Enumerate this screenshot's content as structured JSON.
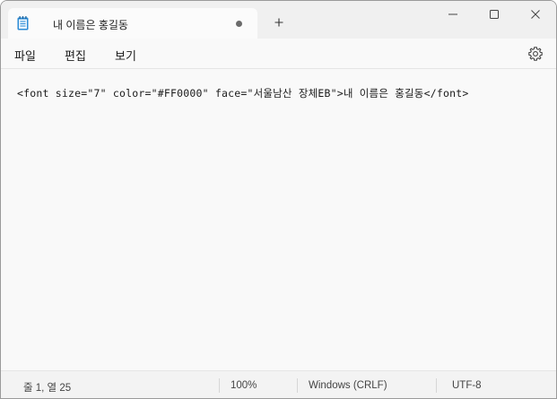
{
  "tab": {
    "title": "내 이름은 홍길동",
    "app_icon": "notepad-icon",
    "unsaved": true
  },
  "titlebar": {
    "new_tab_icon": "plus-icon",
    "controls": [
      "minimize-icon",
      "maximize-icon",
      "close-icon"
    ]
  },
  "menu": {
    "file_label": "파일",
    "edit_label": "편집",
    "view_label": "보기",
    "settings_icon": "gear-icon"
  },
  "editor": {
    "content": "<font size=\"7\" color=\"#FF0000\" face=\"서울남산 장체EB\">내 이름은 홍길동</font>"
  },
  "status": {
    "position": "줄 1, 열 25",
    "zoom": "100%",
    "line_ending": "Windows (CRLF)",
    "encoding": "UTF-8"
  },
  "colors": {
    "titlebar": "#f0f0f0",
    "tab": "#fbfbfb",
    "editor_bg": "#f9f9f9",
    "icon_accent": "#2b8bd6"
  }
}
